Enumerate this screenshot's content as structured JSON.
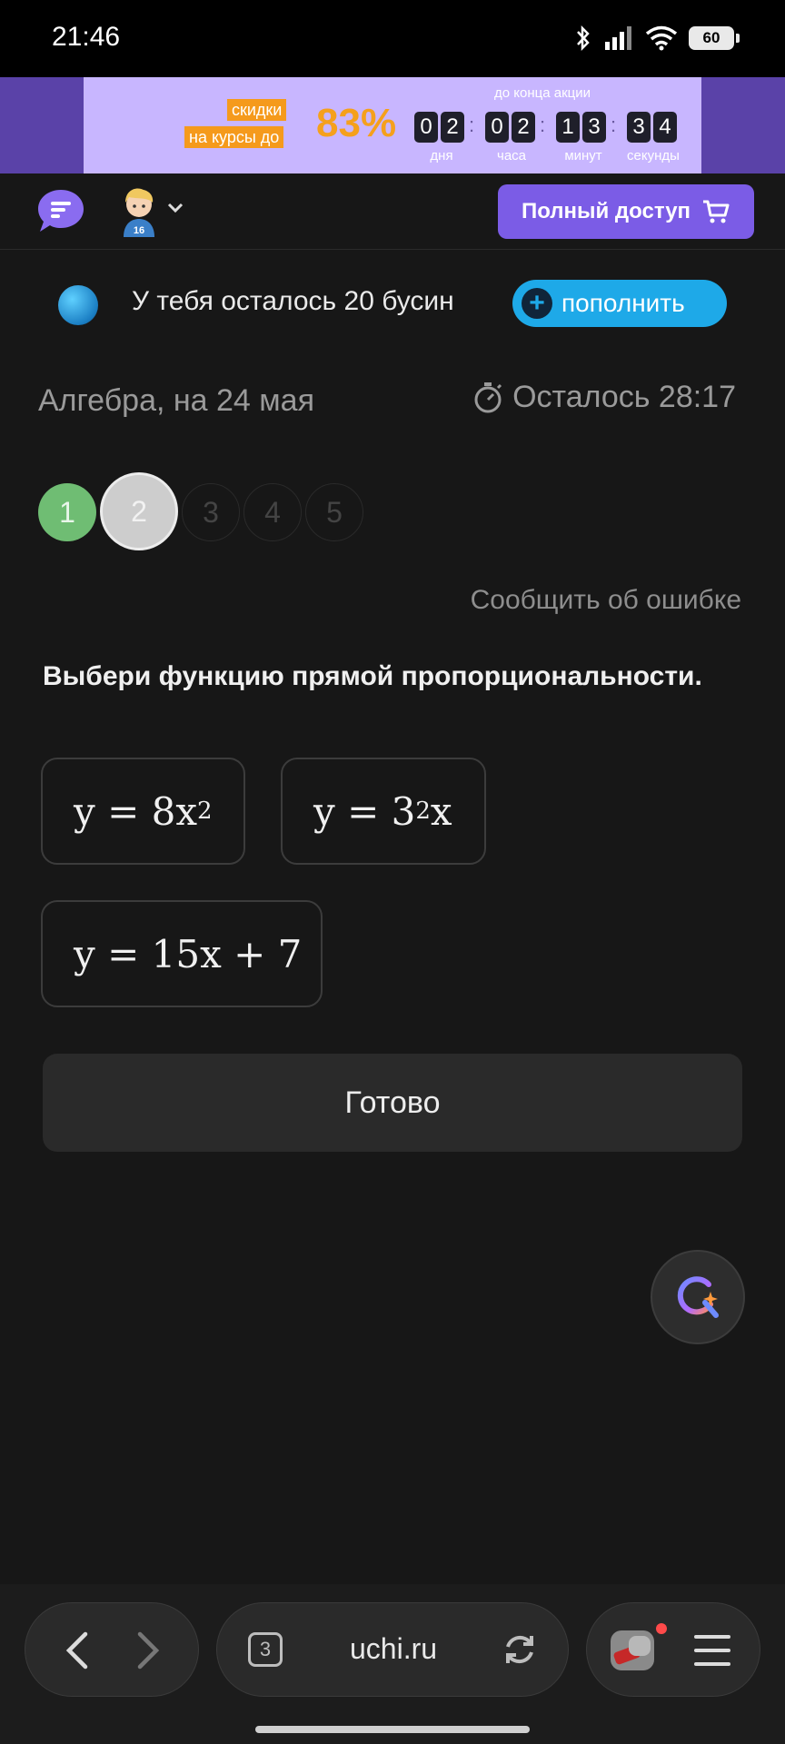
{
  "status_bar": {
    "time": "21:46",
    "battery": "60",
    "icons": [
      "bluetooth-icon",
      "signal-icon",
      "wifi-icon",
      "battery-icon"
    ]
  },
  "promo": {
    "tag_line1": "скидки",
    "tag_line2": "на курсы до",
    "percent": "83%",
    "until_label": "до конца акции",
    "digits": [
      "0",
      "2",
      "0",
      "2",
      "1",
      "3",
      "3",
      "4"
    ],
    "units": [
      "дня",
      "часа",
      "минут",
      "секунды"
    ]
  },
  "header": {
    "full_access_label": "Полный доступ",
    "avatar_badge": "16"
  },
  "beads": {
    "text": "У тебя осталось 20 бусин",
    "topup_label": "пополнить"
  },
  "lesson": {
    "title": "Алгебра, на 24 мая",
    "timer": "Осталось 28:17"
  },
  "steps": [
    "1",
    "2",
    "3",
    "4",
    "5"
  ],
  "report_label": "Сообщить об ошибке",
  "question": "Выбери функцию прямой пропорциональности.",
  "options": [
    {
      "base": "y = 8x",
      "exp": "2",
      "tail": ""
    },
    {
      "base": "y = 3",
      "exp": "2",
      "tail": "x"
    },
    {
      "base": "y = 15x + 7",
      "exp": "",
      "tail": ""
    }
  ],
  "done_label": "Готово",
  "browser": {
    "url": "uchi.ru",
    "tab_count": "3"
  },
  "colors": {
    "accent_purple": "#7b5ce6",
    "promo_bg": "#c8b6ff",
    "promo_orange": "#f59a1c",
    "topup_blue": "#1ea9e8",
    "step_done_green": "#6fbd73",
    "background": "#171717"
  }
}
